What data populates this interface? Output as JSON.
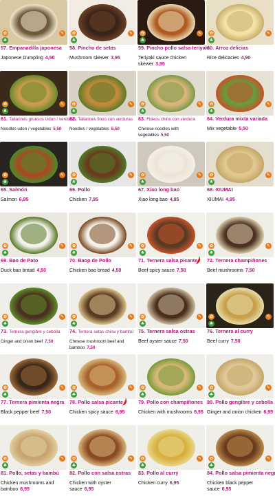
{
  "menu": [
    {
      "num": "57.",
      "name": "Empanadilla japonesa",
      "desc": "Japonese Dumpling",
      "price": "4,50",
      "colors": [
        "#d9c9a2",
        "#6e5a3a",
        "#f0e6cc"
      ]
    },
    {
      "num": "58.",
      "name": "Pincho de setas",
      "desc": "Mushroom skewer",
      "price": "3,95",
      "colors": [
        "#f2ede4",
        "#3a2418",
        "#6a4028"
      ]
    },
    {
      "num": "59.",
      "name": "Pincho pollo salsa teriyaki",
      "desc": "Teriyaki sauce chicken skewer",
      "price": "3,95",
      "colors": [
        "#2a1a12",
        "#b05a22",
        "#e8d9b0"
      ]
    },
    {
      "num": "60.",
      "name": "Arroz delicias",
      "desc": "Rice delicacies",
      "price": "4,90",
      "colors": [
        "#e8dfc6",
        "#f2e3a4",
        "#c8b070"
      ]
    },
    {
      "num": "61.",
      "name": "Tallarines gruesos Udon / verduras",
      "desc": "Noodles udon / vegetables",
      "price": "5,50",
      "colors": [
        "#3a2a1c",
        "#c99b4d",
        "#6b8a2e"
      ],
      "small": true
    },
    {
      "num": "62.",
      "name": "Tallarines finos con verduras",
      "desc": "Noodles / vegetables",
      "price": "5,50",
      "colors": [
        "#d8d2c4",
        "#c08a3c",
        "#5f7a2a"
      ],
      "small": true
    },
    {
      "num": "63.",
      "name": "Fideos chino con verdura",
      "desc": "Chinese noodles with vegetables",
      "price": "5,50",
      "colors": [
        "#e0dccf",
        "#d8b67a",
        "#7e9a4a"
      ],
      "small": true
    },
    {
      "num": "64.",
      "name": "Verdura mixta variada",
      "desc": "Mix vegetable",
      "price": "5,50",
      "colors": [
        "#e6e2d6",
        "#6a9a3a",
        "#c4532c"
      ]
    },
    {
      "num": "65.",
      "name": "Salmón",
      "desc": "Salmon",
      "price": "6,95",
      "colors": [
        "#2a2420",
        "#a84a22",
        "#4b8a2e"
      ]
    },
    {
      "num": "66.",
      "name": "Pollo",
      "desc": "Chicken",
      "price": "7,95",
      "colors": [
        "#e6e6e6",
        "#6a3a1c",
        "#4e7a2a"
      ]
    },
    {
      "num": "67.",
      "name": "Xiao long bao",
      "desc": "Xiao long bao",
      "price": "4,95",
      "colors": [
        "#cfc8bc",
        "#ece6d8",
        "#f4f0e6"
      ]
    },
    {
      "num": "68.",
      "name": "XIUMAI",
      "desc": "XIUMAI",
      "price": "4,95",
      "colors": [
        "#e4dccc",
        "#e0c890",
        "#c4a66a"
      ]
    },
    {
      "num": "69.",
      "name": "Bao de Pato",
      "desc": "Duck bao bread",
      "price": "4,50",
      "colors": [
        "#ebe8e2",
        "#f4f1ea",
        "#5a7a2a"
      ]
    },
    {
      "num": "70.",
      "name": "Baop de Pollo",
      "desc": "Chicken bao bread",
      "price": "4,50",
      "colors": [
        "#ece9e2",
        "#f5f2ea",
        "#7a4a24"
      ]
    },
    {
      "num": "71.",
      "name": "Ternera salsa picante",
      "desc": "Beef spicy sauce",
      "price": "7,50",
      "colors": [
        "#f0efe8",
        "#5a3a22",
        "#c4532c"
      ],
      "chili": true
    },
    {
      "num": "72.",
      "name": "Ternera champiñones",
      "desc": "Beef mushrooms",
      "price": "7,50",
      "colors": [
        "#eeede6",
        "#4c3222",
        "#d8c8a8"
      ]
    },
    {
      "num": "73.",
      "name": "Ternera gengibre y cebolla",
      "desc": "Ginger and onion beef",
      "price": "7,50",
      "colors": [
        "#efeee8",
        "#4a3020",
        "#5e8a2a"
      ],
      "small": true
    },
    {
      "num": "74.",
      "name": "Ternera setas china y bambú",
      "desc": "Chinese mushroom beef and bamboo",
      "price": "7,50",
      "colors": [
        "#efeee8",
        "#5a3a22",
        "#d8c088"
      ],
      "small": true
    },
    {
      "num": "75.",
      "name": "Ternera salsa ostras",
      "desc": "Beef oyster sauce",
      "price": "7,50",
      "colors": [
        "#efeee8",
        "#4a2e1e",
        "#c8b89a"
      ]
    },
    {
      "num": "76.",
      "name": "Ternera al curry",
      "desc": "Beef curry",
      "price": "7,50",
      "colors": [
        "#2a2418",
        "#c8a04a",
        "#e8dca8"
      ]
    },
    {
      "num": "77.",
      "name": "Ternera pimienta negra",
      "desc": "Black pepper beef",
      "price": "7,50",
      "colors": [
        "#efeee8",
        "#3a2618",
        "#9a6a3a"
      ]
    },
    {
      "num": "78.",
      "name": "Pollo salsa picante",
      "desc": "Chicken spicy sauce",
      "price": "6,95",
      "colors": [
        "#efeee8",
        "#a8602c",
        "#d8b87a"
      ],
      "chili": true
    },
    {
      "num": "79.",
      "name": "Pollo con champiñones",
      "desc": "Chicken with mushrooms",
      "price": "6,95",
      "colors": [
        "#efeee8",
        "#d8b878",
        "#7a9a3a"
      ]
    },
    {
      "num": "80.",
      "name": "Pollo gengibre y cebolla",
      "desc": "Ginger and onion chicken",
      "price": "6,95",
      "colors": [
        "#efeee8",
        "#e0c898",
        "#c4a86a"
      ]
    },
    {
      "num": "81.",
      "name": "Pollo, setas y bambú",
      "desc": "Chicken mushrooms and bamboo",
      "price": "6,95",
      "colors": [
        "#efeee8",
        "#c8a470",
        "#e0cfa0"
      ]
    },
    {
      "num": "82.",
      "name": "Pollo con salsa ostras",
      "desc": "Chicken with oyster sauce",
      "price": "6,95",
      "colors": [
        "#efeee8",
        "#8a4a22",
        "#d8b27a"
      ]
    },
    {
      "num": "83.",
      "name": "Pollo al curry",
      "desc": "Chicken curry",
      "price": "6,95",
      "colors": [
        "#efeee8",
        "#d8b040",
        "#e8d688"
      ]
    },
    {
      "num": "84.",
      "name": "Pollo salsa pimienta negra",
      "desc": "Chicken black pepper sauce",
      "price": "6,95",
      "colors": [
        "#efeee8",
        "#6a3a1e",
        "#b88a4a"
      ]
    }
  ]
}
